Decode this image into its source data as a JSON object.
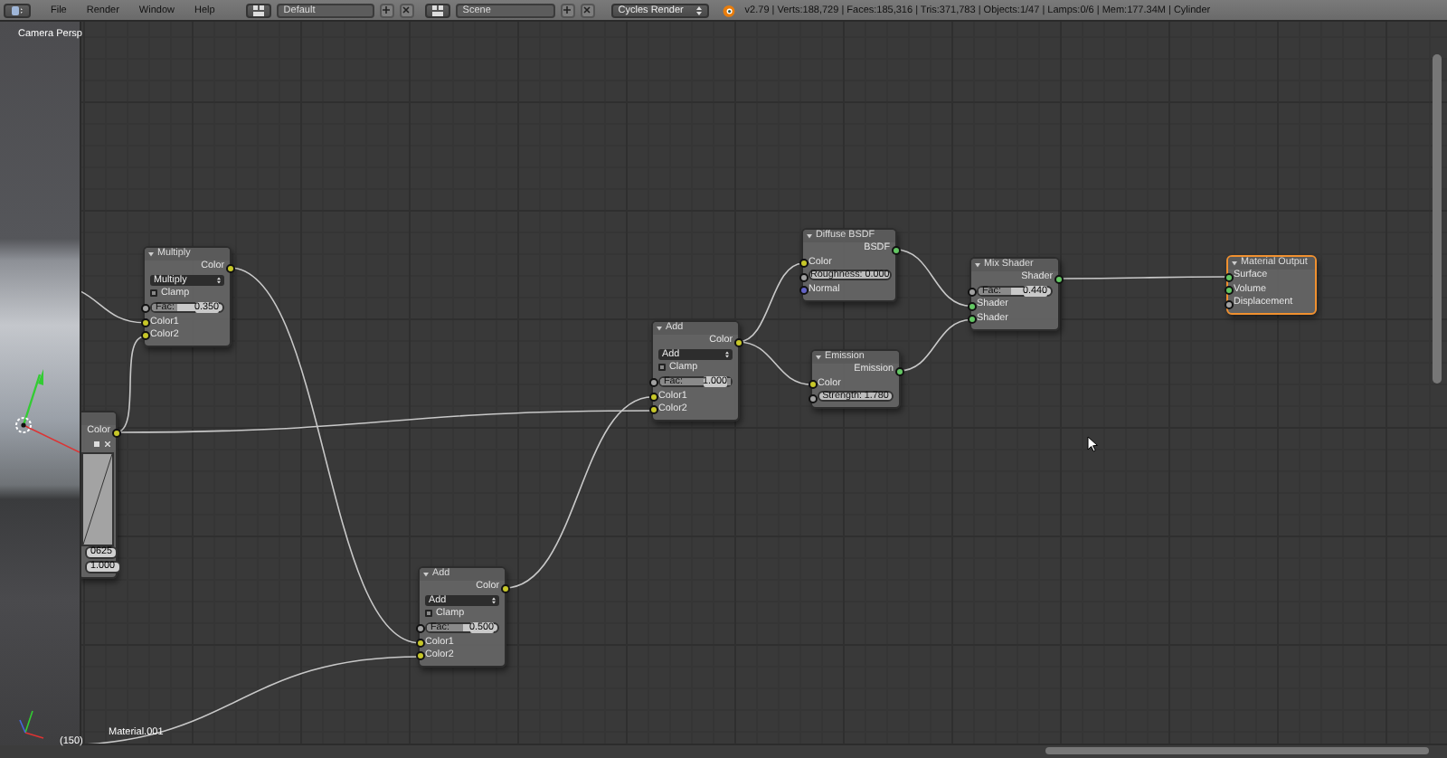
{
  "header": {
    "menus": [
      "File",
      "Render",
      "Window",
      "Help"
    ],
    "layout": "Default",
    "scene": "Scene",
    "engine": "Cycles Render",
    "stats": "v2.79 | Verts:188,729 | Faces:185,316 | Tris:371,783 | Objects:1/47 | Lamps:0/6 | Mem:177.34M | Cylinder"
  },
  "viewport": {
    "label": "Camera Persp",
    "frame": "(150)"
  },
  "node_editor": {
    "material": "Material.001",
    "nodes": [
      {
        "selected": false,
        "rows": [
          {
            "kind": "output",
            "label": "Color",
            "color": "#c7c729"
          },
          {
            "kind": "tools"
          },
          {
            "kind": "curve"
          },
          {
            "kind": "value_field",
            "value": "0625"
          },
          {
            "kind": "value_field",
            "value": "1.000"
          }
        ]
      },
      {
        "title": "Multiply",
        "selected": false,
        "rows": [
          {
            "kind": "output",
            "label": "Color",
            "color": "#c7c729"
          },
          {
            "kind": "dropdown",
            "label": "Multiply"
          },
          {
            "kind": "checkbox",
            "label": "Clamp",
            "checked": false
          },
          {
            "kind": "slider",
            "label": "Fac:",
            "value": "0.350",
            "level": 0.35,
            "color": "#a1a1a1"
          },
          {
            "kind": "input",
            "label": "Color1",
            "color": "#c7c729"
          },
          {
            "kind": "input",
            "label": "Color2",
            "color": "#c7c729"
          }
        ]
      },
      {
        "title": "Add",
        "selected": false,
        "rows": [
          {
            "kind": "output",
            "label": "Color",
            "color": "#c7c729"
          },
          {
            "kind": "dropdown",
            "label": "Add"
          },
          {
            "kind": "checkbox",
            "label": "Clamp",
            "checked": false
          },
          {
            "kind": "slider",
            "label": "Fac:",
            "value": "1.000",
            "level": 1,
            "color": "#a1a1a1"
          },
          {
            "kind": "input",
            "label": "Color1",
            "color": "#c7c729"
          },
          {
            "kind": "input",
            "label": "Color2",
            "color": "#c7c729"
          }
        ]
      },
      {
        "title": "Add",
        "selected": false,
        "rows": [
          {
            "kind": "output",
            "label": "Color",
            "color": "#c7c729"
          },
          {
            "kind": "dropdown",
            "label": "Add"
          },
          {
            "kind": "checkbox",
            "label": "Clamp",
            "checked": false
          },
          {
            "kind": "slider",
            "label": "Fac:",
            "value": "0.500",
            "level": 0.5,
            "color": "#a1a1a1"
          },
          {
            "kind": "input",
            "label": "Color1",
            "color": "#c7c729"
          },
          {
            "kind": "input",
            "label": "Color2",
            "color": "#c7c729"
          }
        ]
      },
      {
        "title": "Diffuse BSDF",
        "selected": false,
        "rows": [
          {
            "kind": "output",
            "label": "BSDF",
            "color": "#63c763"
          },
          {
            "kind": "input",
            "label": "Color",
            "color": "#c7c729"
          },
          {
            "kind": "number",
            "label": "Roughness:",
            "value": "0.000",
            "color": "#a1a1a1"
          },
          {
            "kind": "input",
            "label": "Normal",
            "color": "#6363c7"
          }
        ]
      },
      {
        "title": "Emission",
        "selected": false,
        "rows": [
          {
            "kind": "output",
            "label": "Emission",
            "color": "#63c763"
          },
          {
            "kind": "input",
            "label": "Color",
            "color": "#c7c729"
          },
          {
            "kind": "number",
            "label": "Strength:",
            "value": "1.780",
            "color": "#a1a1a1"
          }
        ]
      },
      {
        "title": "Mix Shader",
        "selected": false,
        "rows": [
          {
            "kind": "output",
            "label": "Shader",
            "color": "#63c763"
          },
          {
            "kind": "slider",
            "label": "Fac:",
            "value": "0.440",
            "level": 0.44,
            "color": "#a1a1a1"
          },
          {
            "kind": "input",
            "label": "Shader",
            "color": "#63c763"
          },
          {
            "kind": "input",
            "label": "Shader",
            "color": "#63c763"
          }
        ]
      },
      {
        "title": "Material Output",
        "selected": true,
        "rows": [
          {
            "kind": "input",
            "label": "Surface",
            "color": "#63c763"
          },
          {
            "kind": "input",
            "label": "Volume",
            "color": "#63c763"
          },
          {
            "kind": "input",
            "label": "Displacement",
            "color": "#a1a1a1"
          }
        ]
      }
    ]
  }
}
